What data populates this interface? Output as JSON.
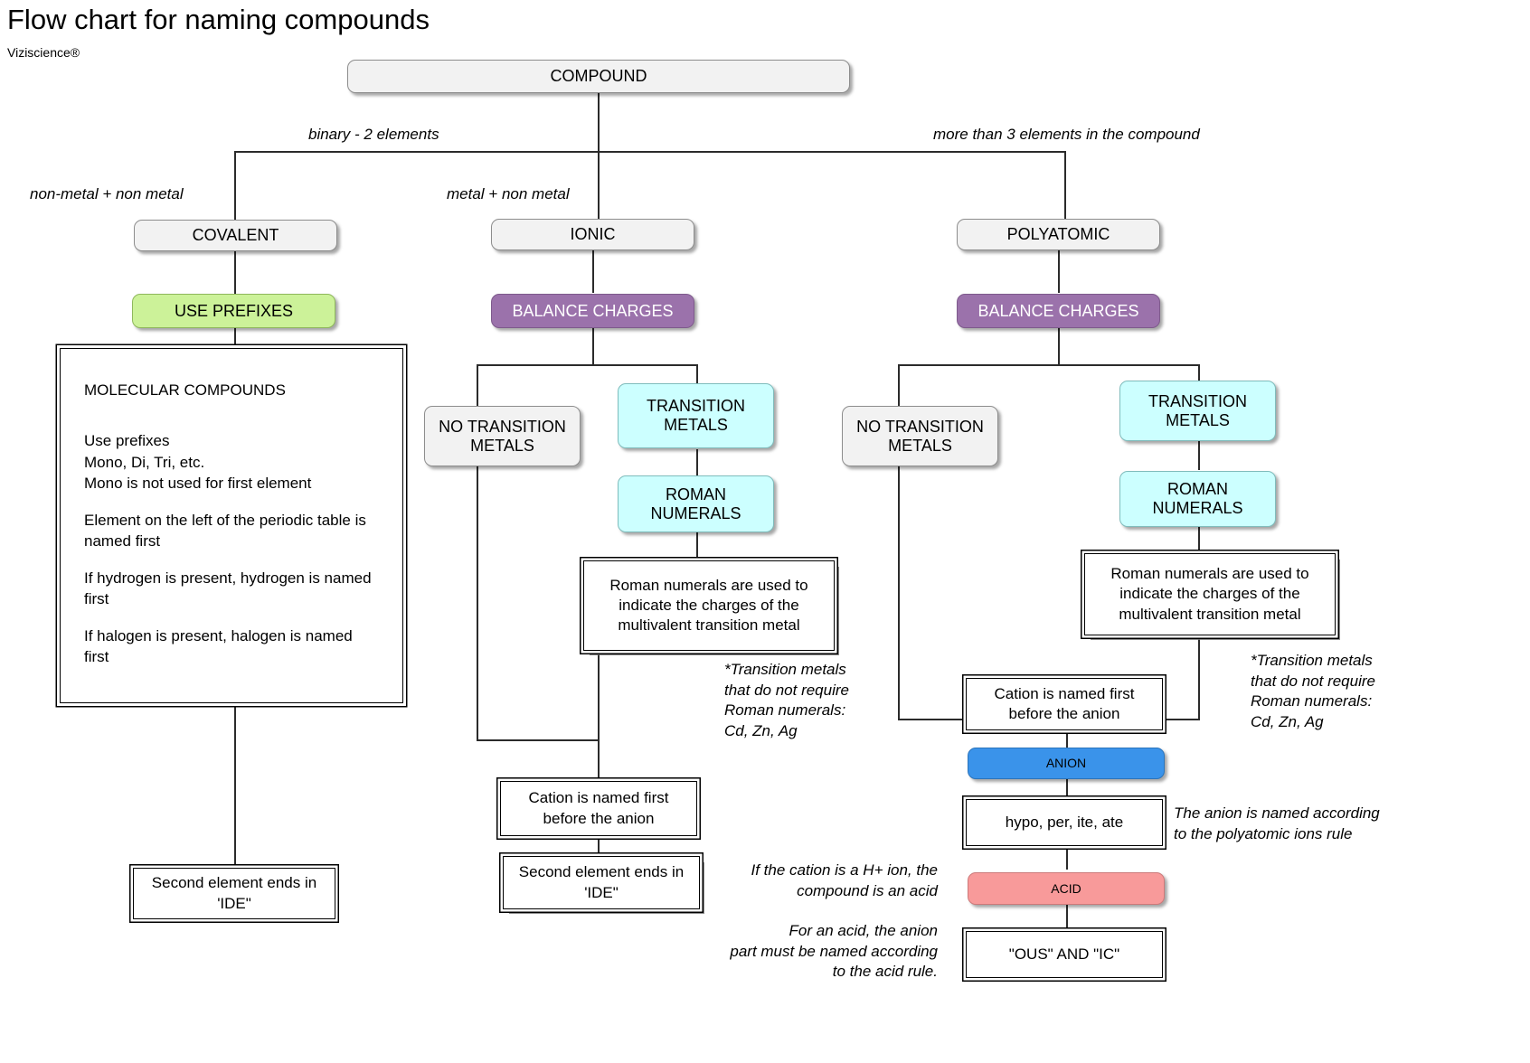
{
  "header": {
    "title": "Flow chart for naming compounds",
    "brand": "Viziscience®"
  },
  "nodes": {
    "compound": "COMPOUND",
    "covalent": "COVALENT",
    "use_prefixes": "USE PREFIXES",
    "ionic": "IONIC",
    "ionic_balance": "BALANCE CHARGES",
    "ionic_no_transition": "NO TRANSITION METALS",
    "ionic_transition": "TRANSITION METALS",
    "ionic_roman": "ROMAN NUMERALS",
    "poly": "POLYATOMIC",
    "poly_balance": "BALANCE CHARGES",
    "poly_no_transition": "NO TRANSITION METALS",
    "poly_transition": "TRANSITION METALS",
    "poly_roman": "ROMAN NUMERALS",
    "anion": "ANION",
    "acid": "ACID"
  },
  "edge_labels": {
    "binary": "binary - 2 elements",
    "more_than_3": "more than 3 elements in the compound",
    "nonmetal_nonmetal": "non-metal + non metal",
    "metal_nonmetal": "metal + non metal"
  },
  "boxes": {
    "molecular_title": "MOLECULAR COMPOUNDS",
    "molecular_lines": [
      "Use prefixes\nMono, Di, Tri, etc.\nMono is not used for first element",
      "Element on the left of the periodic table is named first",
      "If hydrogen is present, hydrogen is named first",
      "If halogen is present, halogen is named first"
    ],
    "covalent_second_ide": "Second element ends in 'IDE\"",
    "ionic_roman_explain": "Roman numerals are used to indicate the charges of the multivalent transition metal",
    "ionic_cation_first": "Cation is named first before the anion",
    "ionic_second_ide": "Second element ends in 'IDE\"",
    "poly_roman_explain": "Roman numerals are used to indicate the charges of the multivalent transition metal",
    "poly_cation_first": "Cation is named first before the anion",
    "poly_hypo": "hypo, per, ite, ate",
    "poly_ous_ic": "\"OUS\" AND \"IC\""
  },
  "notes": {
    "ionic_transition_note": "*Transition metals\nthat do not require\nRoman numerals:\nCd, Zn, Ag",
    "poly_transition_note": "*Transition metals\nthat do not require\nRoman numerals:\nCd, Zn, Ag",
    "anion_rule": "The anion is named according\nto the polyatomic ions rule",
    "acid_cation": "If the cation is a H+ ion, the\ncompound is an acid",
    "acid_rule": "For an acid, the anion\npart must be named according\nto the acid rule."
  },
  "colors": {
    "grey_node": "#f2f2f2",
    "green_node": "#ccf299",
    "purple_node": "#9b72ab",
    "cyan_node": "#ccffff",
    "blue_node": "#3a93ea",
    "pink_node": "#f89a9a",
    "line": "#2b2b2b"
  }
}
